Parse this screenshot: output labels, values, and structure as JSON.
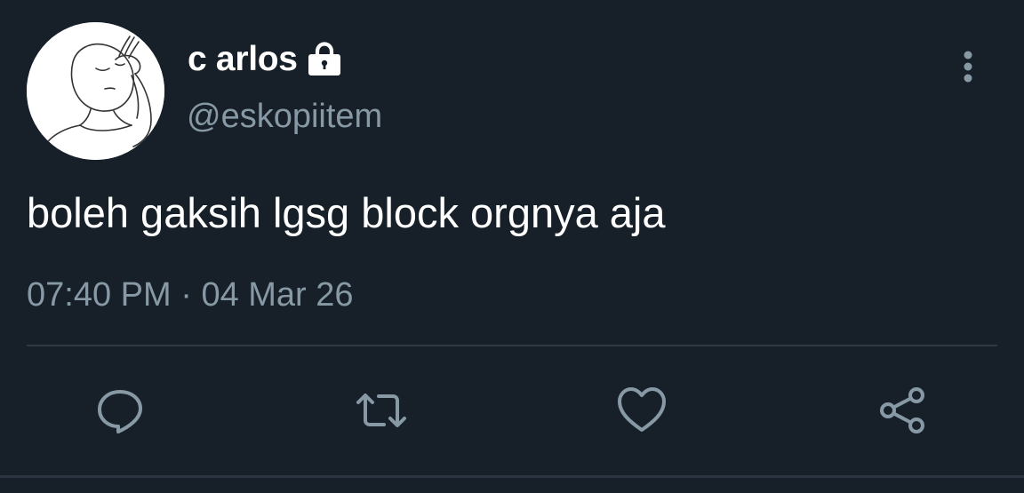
{
  "user": {
    "display_name": "c arlos",
    "handle": "@eskopiitem",
    "protected": true
  },
  "tweet": {
    "text": "boleh gaksih lgsg block orgnya aja",
    "time": "07:40 PM",
    "separator": "·",
    "date": "04 Mar 26"
  },
  "actions": [
    "reply-icon",
    "retweet-icon",
    "like-icon",
    "share-icon"
  ],
  "colors": {
    "background": "#172029",
    "text": "#ffffff",
    "secondary_text": "#8899a6",
    "divider": "#2f3a45"
  }
}
